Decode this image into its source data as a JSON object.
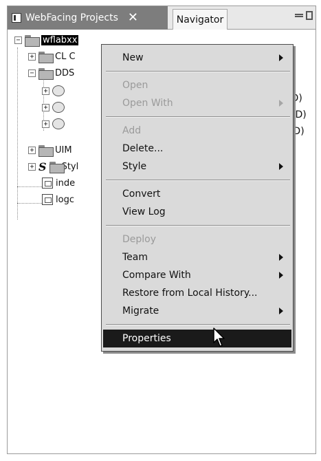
{
  "tabs": [
    {
      "label": "WebFacing Projects",
      "active": true
    },
    {
      "label": "Navigator",
      "active": false
    }
  ],
  "tree": {
    "project": "wflabxx",
    "items": [
      {
        "label": "CL C"
      },
      {
        "label": "DDS"
      },
      {
        "label": "UIM"
      },
      {
        "label": "Styl"
      },
      {
        "label": "inde"
      },
      {
        "label": "logc"
      }
    ],
    "dds_children_suffixes": [
      "TD)",
      "STD)",
      "LTD)"
    ]
  },
  "context_menu": {
    "items": [
      {
        "label": "New",
        "enabled": true,
        "submenu": true
      },
      {
        "label": "Open",
        "enabled": false,
        "submenu": false
      },
      {
        "label": "Open With",
        "enabled": false,
        "submenu": true
      },
      {
        "label": "Add",
        "enabled": false,
        "submenu": false
      },
      {
        "label": "Delete...",
        "enabled": true,
        "submenu": false
      },
      {
        "label": "Style",
        "enabled": true,
        "submenu": true
      },
      {
        "label": "Convert",
        "enabled": true,
        "submenu": false
      },
      {
        "label": "View Log",
        "enabled": true,
        "submenu": false
      },
      {
        "label": "Deploy",
        "enabled": false,
        "submenu": false
      },
      {
        "label": "Team",
        "enabled": true,
        "submenu": true
      },
      {
        "label": "Compare With",
        "enabled": true,
        "submenu": true
      },
      {
        "label": "Restore from Local History...",
        "enabled": true,
        "submenu": false
      },
      {
        "label": "Migrate",
        "enabled": true,
        "submenu": true
      },
      {
        "label": "Properties",
        "enabled": true,
        "submenu": false,
        "selected": true
      }
    ]
  },
  "colors": {
    "active_tab": "#7d7d7d",
    "menu_background": "#dadada",
    "selection": "#1a1a1a",
    "disabled_text": "#9a9a9a"
  },
  "icons": [
    "view-icon",
    "close-icon",
    "minimize-icon",
    "maximize-icon",
    "folder-icon",
    "file-icon",
    "member-icon",
    "submenu-arrow-icon",
    "mouse-pointer-icon"
  ]
}
